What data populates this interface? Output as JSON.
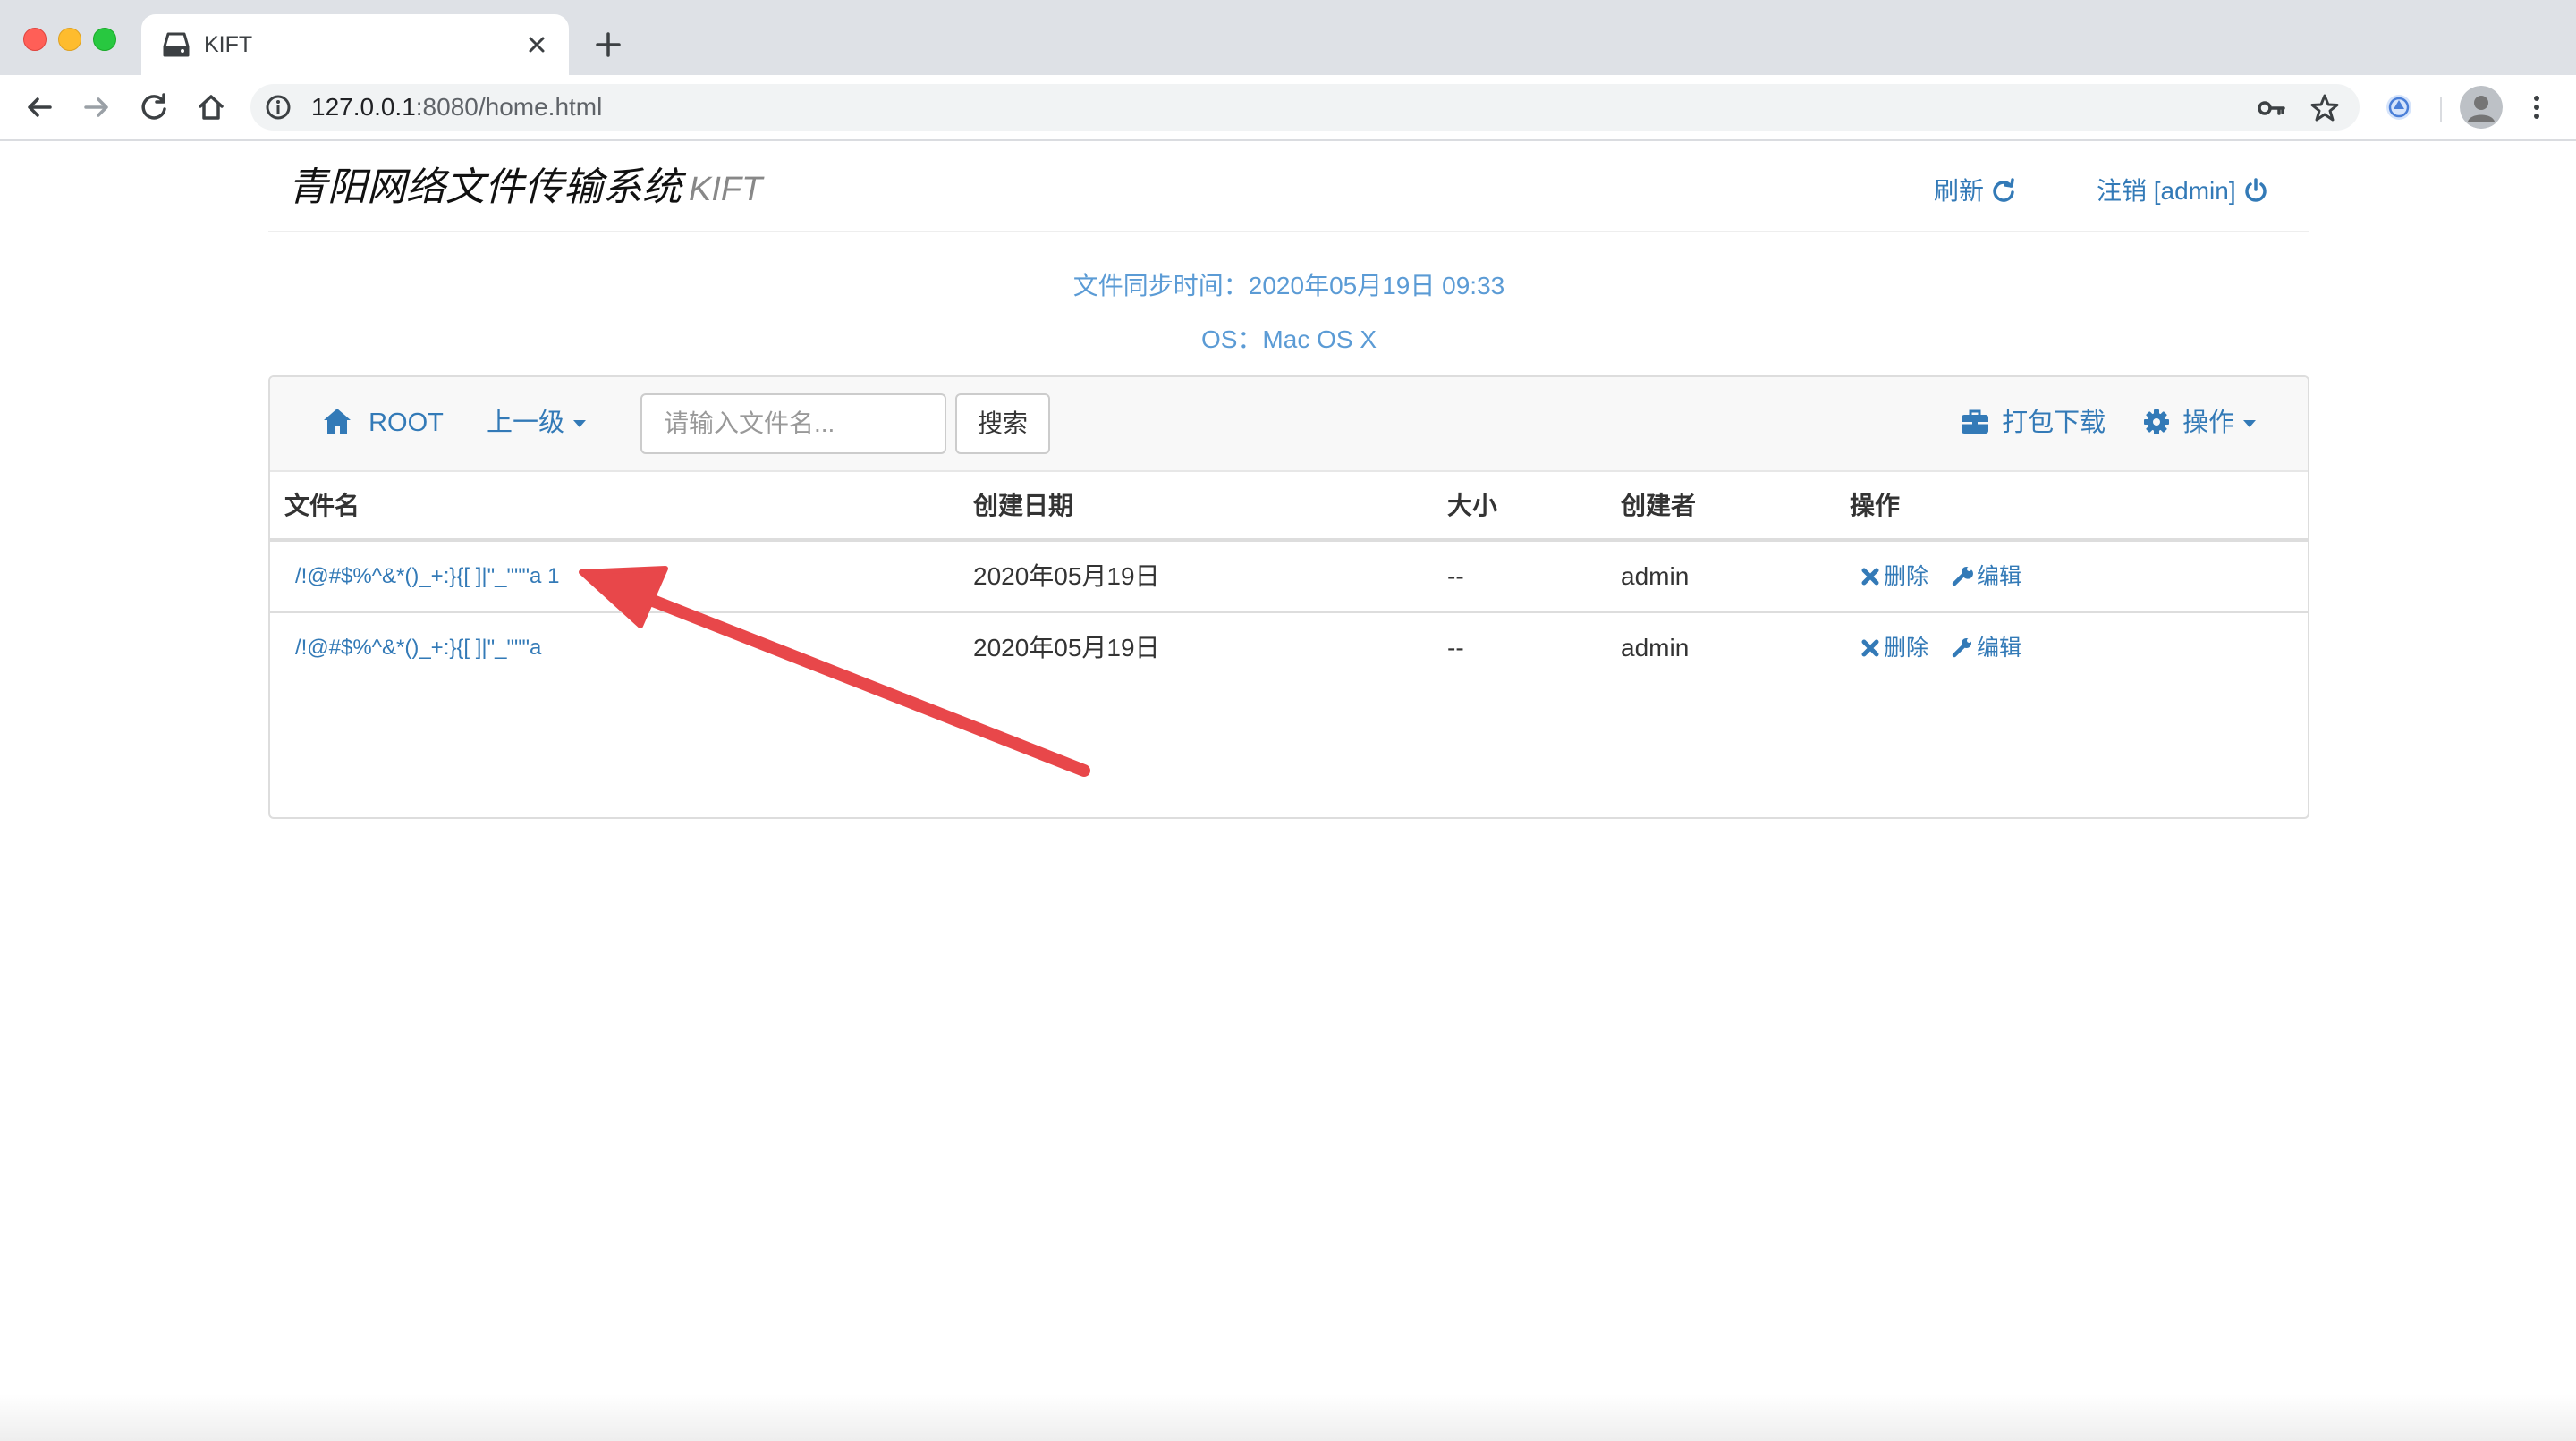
{
  "browser": {
    "tab_title": "KIFT",
    "url_host": "127.0.0.1",
    "url_rest": ":8080/home.html"
  },
  "header": {
    "brand_title": "青阳网络文件传输系统",
    "brand_sub": "KIFT",
    "refresh_label": "刷新",
    "logout_label": "注销 [admin]"
  },
  "info": {
    "sync_time": "文件同步时间：2020年05月19日 09:33",
    "os": "OS：Mac OS X"
  },
  "toolbar": {
    "root_label": "ROOT",
    "parent_label": "上一级",
    "search_placeholder": "请输入文件名...",
    "search_button": "搜索",
    "pack_download_label": "打包下载",
    "operations_label": "操作"
  },
  "table": {
    "headers": [
      "文件名",
      "创建日期",
      "大小",
      "创建者",
      "操作"
    ],
    "rows": [
      {
        "name": "/!@#$%^&*()_+:}{[ ]|\"_\"\"\"a 1",
        "date": "2020年05月19日",
        "size": "--",
        "creator": "admin",
        "delete": "删除",
        "edit": "编辑"
      },
      {
        "name": "/!@#$%^&*()_+:}{[ ]|\"_\"\"\"a",
        "date": "2020年05月19日",
        "size": "--",
        "creator": "admin",
        "delete": "删除",
        "edit": "编辑"
      }
    ]
  },
  "colors": {
    "link": "#337ab7",
    "info_text": "#5b9bd5",
    "annotation_arrow": "#e8474a"
  },
  "icons": [
    "home-icon",
    "refresh-icon",
    "power-icon",
    "briefcase-icon",
    "gear-icon",
    "remove-icon",
    "wrench-icon"
  ]
}
